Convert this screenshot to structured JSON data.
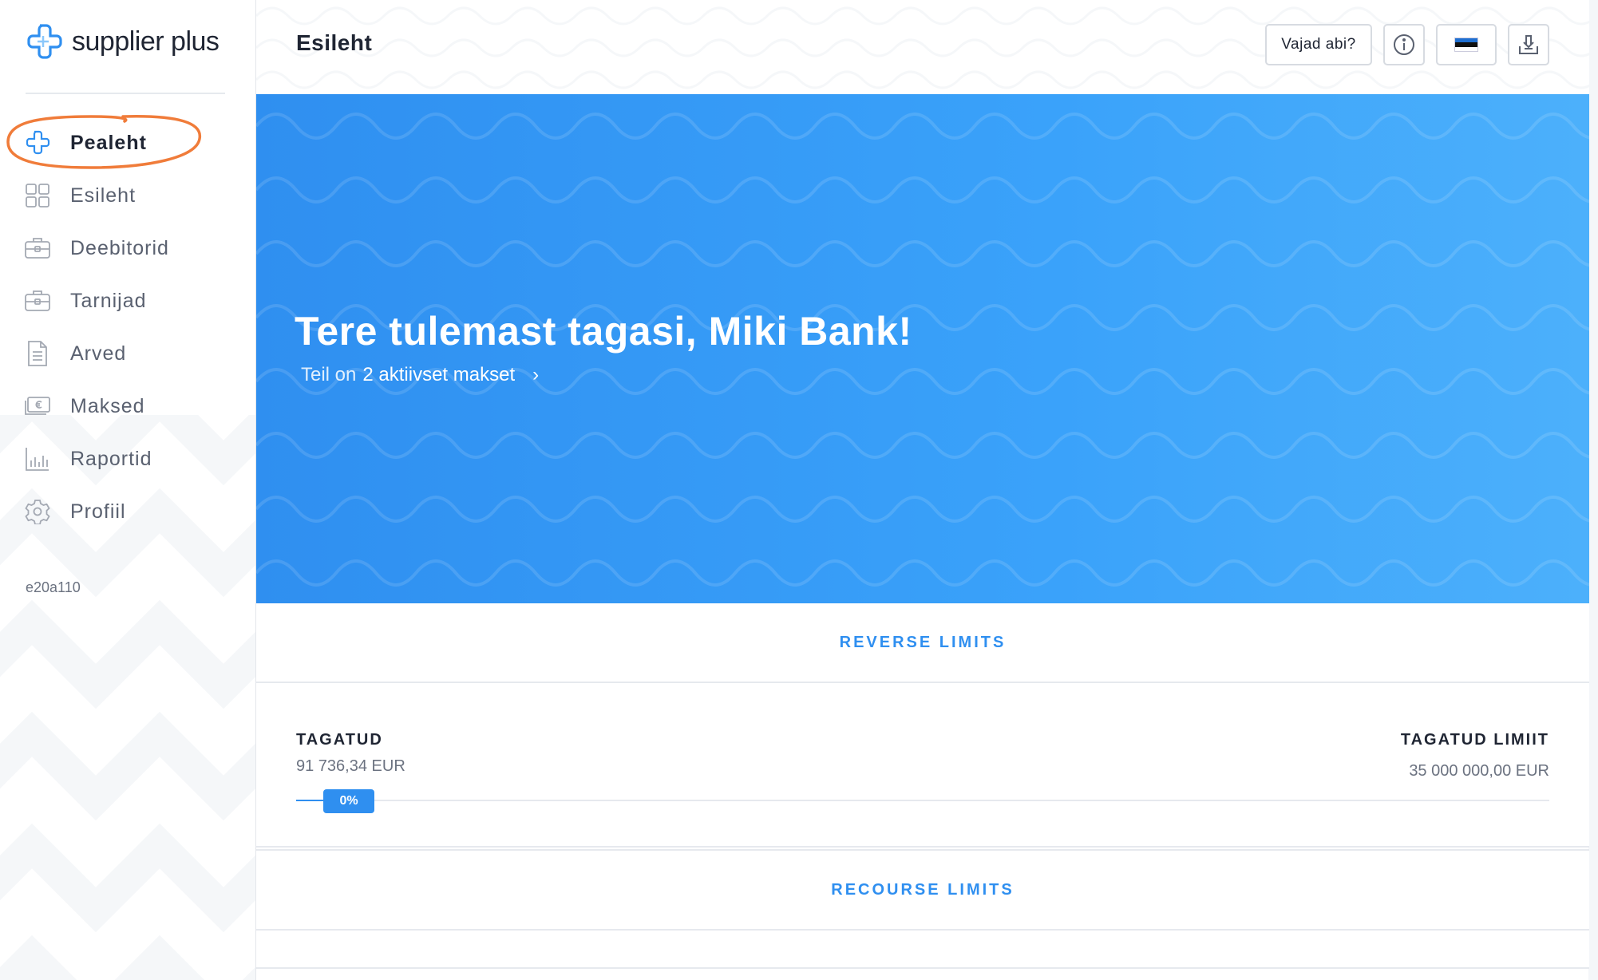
{
  "brand": {
    "logo_text_light": "supplier",
    "logo_text_bold": "plus"
  },
  "sidebar": {
    "items": [
      {
        "label": "Pealeht",
        "icon": "plus-logo-icon",
        "active": true
      },
      {
        "label": "Esileht",
        "icon": "grid-icon",
        "active": false
      },
      {
        "label": "Deebitorid",
        "icon": "briefcase-icon",
        "active": false
      },
      {
        "label": "Tarnijad",
        "icon": "briefcase-icon",
        "active": false
      },
      {
        "label": "Arved",
        "icon": "document-icon",
        "active": false
      },
      {
        "label": "Maksed",
        "icon": "euro-bill-icon",
        "active": false
      },
      {
        "label": "Raportid",
        "icon": "bar-chart-icon",
        "active": false
      },
      {
        "label": "Profiil",
        "icon": "gear-icon",
        "active": false
      }
    ],
    "version": "e20a110"
  },
  "header": {
    "title": "Esileht",
    "help_label": "Vajad abi?",
    "info_icon": "info-icon",
    "language_icon": "estonia-flag-icon",
    "logout_icon": "logout-icon"
  },
  "hero": {
    "title": "Tere tulemast tagasi, Miki Bank!",
    "subtitle_prefix": "Teil on",
    "subtitle_link": "2 aktiivset makset",
    "chevron": "›"
  },
  "reverse_limits": {
    "heading": "REVERSE LIMITS",
    "left_label": "TAGATUD",
    "left_value": "91 736,34 EUR",
    "right_label": "TAGATUD LIMIIT",
    "right_value": "35 000 000,00 EUR",
    "progress_badge": "0%",
    "progress_percent": 0
  },
  "recourse_limits": {
    "heading": "RECOURSE LIMITS"
  },
  "colors": {
    "accent": "#2f8ff0",
    "hero_start": "#2f8ff0",
    "hero_end": "#4cb0fb",
    "highlight_ring": "#f07c3a"
  }
}
